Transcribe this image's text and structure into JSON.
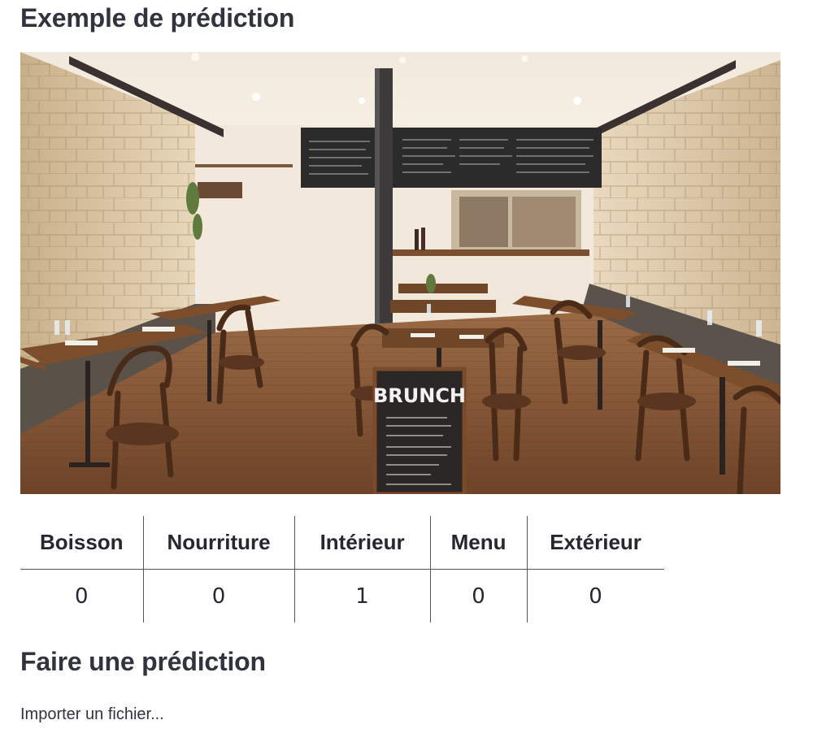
{
  "sections": {
    "example_title": "Exemple de prédiction",
    "predict_title": "Faire une prédiction"
  },
  "image": {
    "alt": "restaurant-interior-photo",
    "chalkboard_title": "BRUNCH"
  },
  "table": {
    "headers": [
      "Boisson",
      "Nourriture",
      "Intérieur",
      "Menu",
      "Extérieur"
    ],
    "values": [
      "0",
      "0",
      "1",
      "0",
      "0"
    ]
  },
  "upload": {
    "label": "Importer un fichier..."
  },
  "colors": {
    "text": "#31333f",
    "border": "#555555"
  }
}
